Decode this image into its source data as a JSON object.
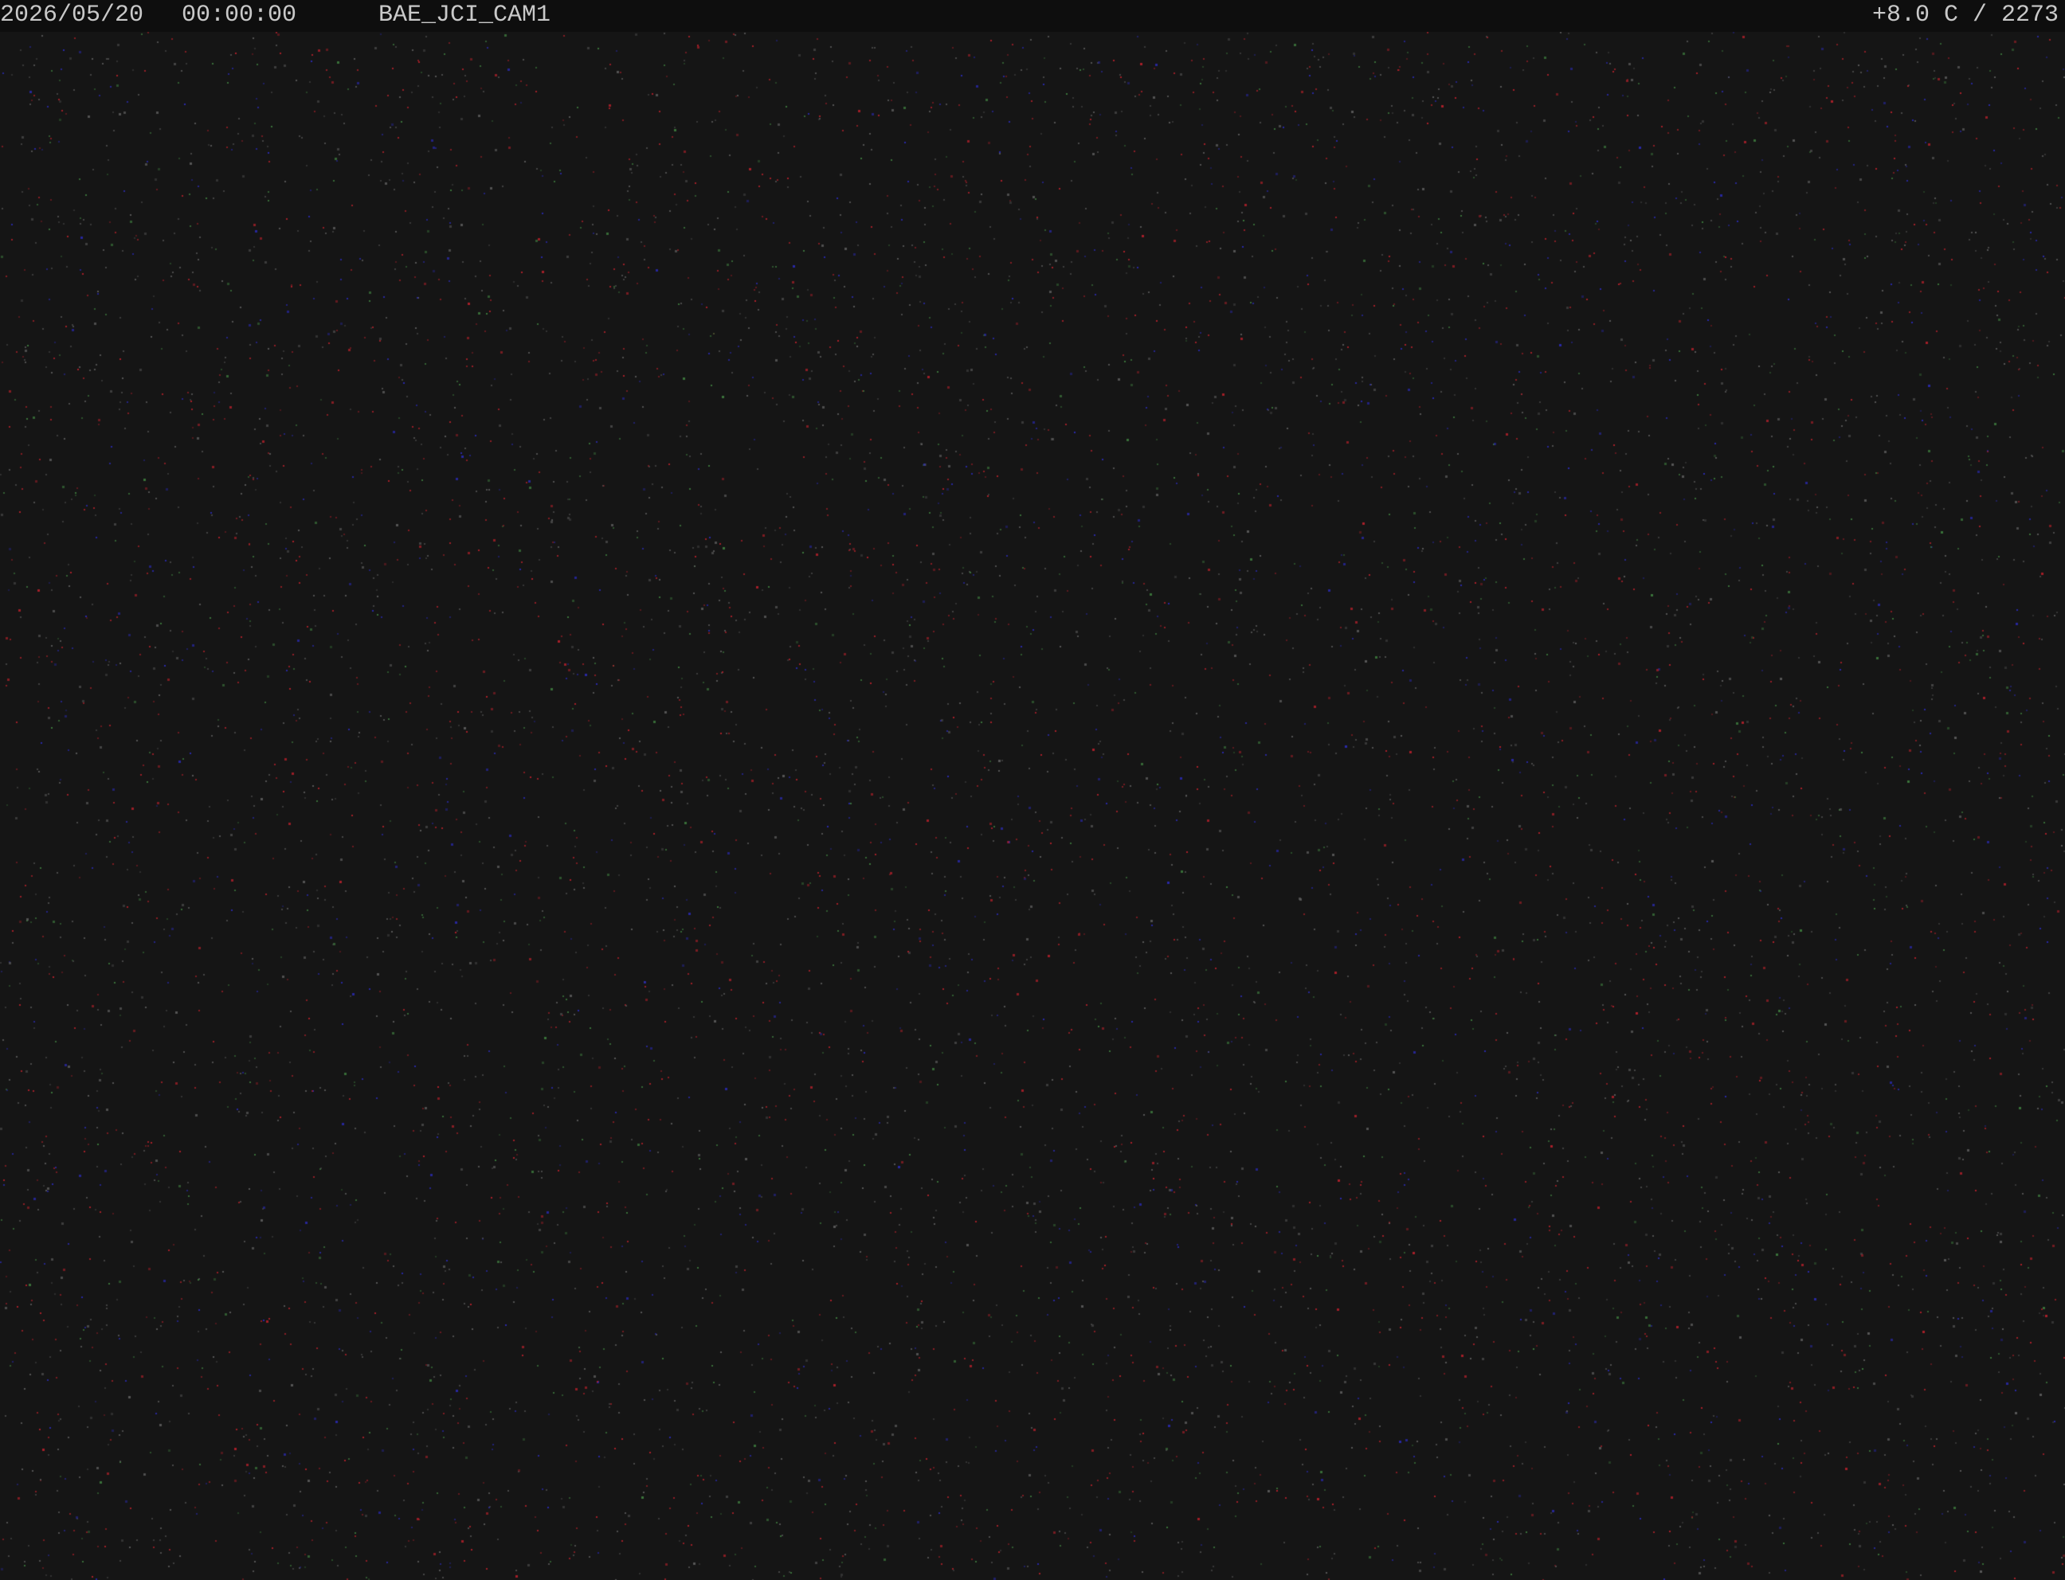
{
  "overlay": {
    "date": "2026/05/20",
    "time": "00:00:00",
    "camera_name": "BAE_JCI_CAM1",
    "sensor_readout": "+8.0 C / 2273"
  },
  "colors": {
    "frame_background": "#151515",
    "header_background": "#0e0e0e",
    "header_text": "#c9c9c9",
    "noise_red": "#b0202a",
    "noise_blue": "#2a2ab0",
    "noise_green": "#3d7a3d",
    "noise_gray": "#5a5a5a"
  }
}
